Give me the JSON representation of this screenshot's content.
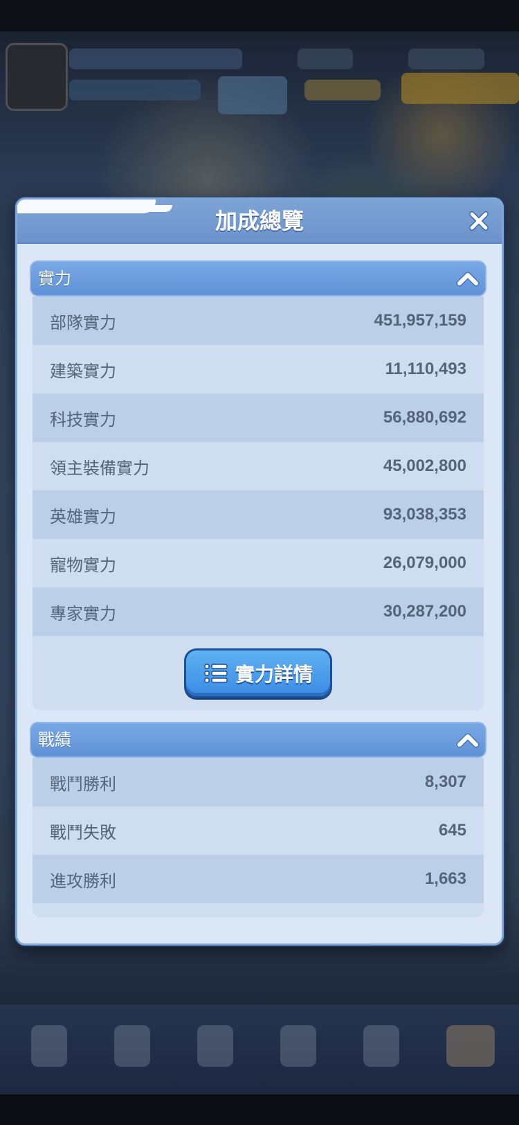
{
  "dialog": {
    "title": "加成總覽"
  },
  "sections": [
    {
      "title": "實力",
      "rows": [
        {
          "label": "部隊實力",
          "value": "451,957,159"
        },
        {
          "label": "建築實力",
          "value": "11,110,493"
        },
        {
          "label": "科技實力",
          "value": "56,880,692"
        },
        {
          "label": "領主裝備實力",
          "value": "45,002,800"
        },
        {
          "label": "英雄實力",
          "value": "93,038,353"
        },
        {
          "label": "寵物實力",
          "value": "26,079,000"
        },
        {
          "label": "專家實力",
          "value": "30,287,200"
        }
      ],
      "button_label": "實力詳情"
    },
    {
      "title": "戰績",
      "rows": [
        {
          "label": "戰鬥勝利",
          "value": "8,307"
        },
        {
          "label": "戰鬥失敗",
          "value": "645"
        },
        {
          "label": "進攻勝利",
          "value": "1,663"
        }
      ]
    }
  ],
  "colors": {
    "header_blue": "#6b93cc",
    "section_blue": "#5f92d6",
    "button_blue": "#3b8be3",
    "text_gray": "#556579"
  }
}
